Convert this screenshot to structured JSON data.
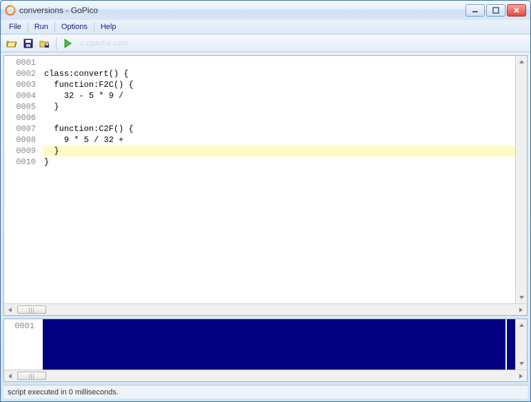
{
  "window": {
    "title": "conversions - GoPico"
  },
  "menu": {
    "file": "File",
    "run": "Run",
    "options": "Options",
    "help": "Help"
  },
  "toolbar": {
    "open": "open-icon",
    "save": "save-icon",
    "save_dir": "save-dir-icon",
    "run": "run-icon",
    "watermark": "c.cpedia.com"
  },
  "editor": {
    "highlight_line": 9,
    "lines": [
      {
        "num": "0001",
        "text": ""
      },
      {
        "num": "0002",
        "text": "class:convert() {"
      },
      {
        "num": "0003",
        "text": "  function:F2C() {"
      },
      {
        "num": "0004",
        "text": "    32 - 5 * 9 /"
      },
      {
        "num": "0005",
        "text": "  }"
      },
      {
        "num": "0006",
        "text": ""
      },
      {
        "num": "0007",
        "text": "  function:C2F() {"
      },
      {
        "num": "0008",
        "text": "    9 * 5 / 32 +"
      },
      {
        "num": "0009",
        "text": "  }"
      },
      {
        "num": "0010",
        "text": "}"
      }
    ]
  },
  "output": {
    "line_num": "0001"
  },
  "status": {
    "text": "script executed in 0 milliseconds."
  },
  "colors": {
    "highlight": "#fffbc5",
    "output_bg": "#000080"
  }
}
